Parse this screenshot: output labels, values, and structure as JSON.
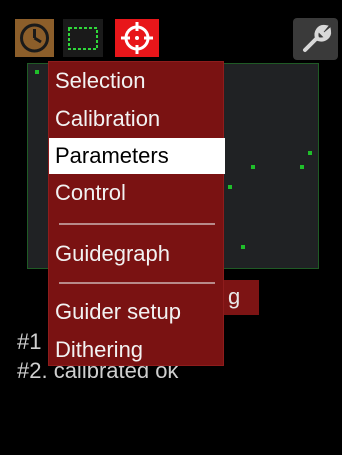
{
  "toolbar": {
    "clock_icon": "clock-icon",
    "selection_icon": "dashed-rectangle-icon",
    "guide_icon": "crosshair-icon",
    "tools_icon": "wrench-icon"
  },
  "underlying": {
    "button_fragment": "g",
    "status_lines": [
      "#1",
      "#2. calibrated ok"
    ]
  },
  "menu": {
    "items": [
      {
        "label": "Selection",
        "active": false
      },
      {
        "label": "Calibration",
        "active": false
      },
      {
        "label": "Parameters",
        "active": true
      },
      {
        "label": "Control",
        "active": false
      },
      {
        "label": "Guidegraph",
        "active": false
      },
      {
        "label": "Guider setup",
        "active": false
      },
      {
        "label": "Dithering",
        "active": false
      }
    ]
  },
  "colors": {
    "menu_bg": "#7a1212",
    "menu_active_bg": "#ffffff",
    "accent_red": "#e8161a",
    "graph_green": "#1fbf2a"
  }
}
